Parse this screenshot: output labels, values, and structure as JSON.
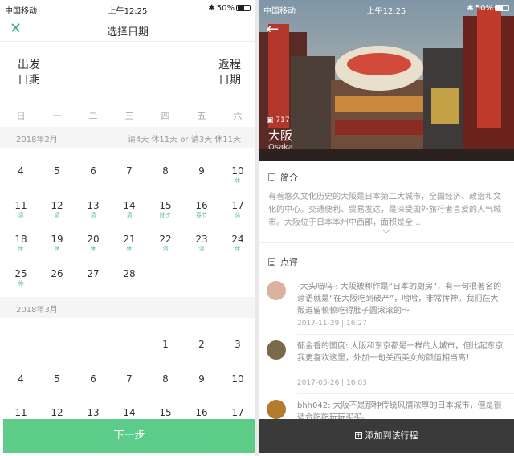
{
  "status_left": {
    "carrier": "中国移动",
    "time": "上午12:25",
    "battery": "50%"
  },
  "status_right": {
    "carrier": "中国移动",
    "time": "上午12:25",
    "battery": "50%"
  },
  "calendar": {
    "close_icon": "close-icon",
    "title": "选择日期",
    "departure": [
      "出发",
      "日期"
    ],
    "return": [
      "返程",
      "日期"
    ],
    "weekdays": [
      "日",
      "一",
      "二",
      "三",
      "四",
      "五",
      "六"
    ],
    "months": [
      {
        "label": "2018年2月",
        "note": "请4天 休11天 or 请3天 休11天",
        "rows": [
          [
            {
              "d": "4",
              "t": ""
            },
            {
              "d": "5",
              "t": ""
            },
            {
              "d": "6",
              "t": ""
            },
            {
              "d": "7",
              "t": ""
            },
            {
              "d": "8",
              "t": ""
            },
            {
              "d": "9",
              "t": ""
            },
            {
              "d": "10",
              "t": "休"
            }
          ],
          [
            {
              "d": "11",
              "t": "请"
            },
            {
              "d": "12",
              "t": "请"
            },
            {
              "d": "13",
              "t": "请"
            },
            {
              "d": "14",
              "t": "请"
            },
            {
              "d": "15",
              "t": "除夕"
            },
            {
              "d": "16",
              "t": "春节"
            },
            {
              "d": "17",
              "t": "休"
            }
          ],
          [
            {
              "d": "18",
              "t": "休"
            },
            {
              "d": "19",
              "t": "休"
            },
            {
              "d": "20",
              "t": "休"
            },
            {
              "d": "21",
              "t": "休"
            },
            {
              "d": "22",
              "t": "请"
            },
            {
              "d": "23",
              "t": "请"
            },
            {
              "d": "24",
              "t": "休"
            }
          ],
          [
            {
              "d": "25",
              "t": "休"
            },
            {
              "d": "26",
              "t": ""
            },
            {
              "d": "27",
              "t": ""
            },
            {
              "d": "28",
              "t": ""
            }
          ]
        ]
      },
      {
        "label": "2018年3月",
        "note": "",
        "rows": [
          [
            {
              "d": "",
              "t": ""
            },
            {
              "d": "",
              "t": ""
            },
            {
              "d": "",
              "t": ""
            },
            {
              "d": "",
              "t": ""
            },
            {
              "d": "1",
              "t": ""
            },
            {
              "d": "2",
              "t": ""
            },
            {
              "d": "3",
              "t": ""
            }
          ],
          [
            {
              "d": "4",
              "t": ""
            },
            {
              "d": "5",
              "t": ""
            },
            {
              "d": "6",
              "t": ""
            },
            {
              "d": "7",
              "t": ""
            },
            {
              "d": "8",
              "t": ""
            },
            {
              "d": "9",
              "t": ""
            },
            {
              "d": "10",
              "t": ""
            }
          ],
          [
            {
              "d": "11",
              "t": ""
            },
            {
              "d": "12",
              "t": ""
            },
            {
              "d": "13",
              "t": ""
            },
            {
              "d": "14",
              "t": ""
            },
            {
              "d": "15",
              "t": ""
            },
            {
              "d": "16",
              "t": ""
            },
            {
              "d": "17",
              "t": ""
            }
          ]
        ]
      }
    ],
    "next_button": "下一步",
    "accent_color": "#55c983"
  },
  "city": {
    "back_icon": "back-arrow-icon",
    "photo_count": "717",
    "name": "大阪",
    "name_en": "Osaka",
    "intro_heading": "简介",
    "intro_text": "有着悠久文化历史的大阪是日本第二大城市，全国经济、政治和文化的中心。交通便利、贸易发达，是深受国外旅行者喜爱的人气城市。大阪位于日本本州中西部，面积是全…",
    "expand_icon": "chevron-down-icon",
    "reviews_heading": "点评",
    "reviews": [
      {
        "text": "-大头喵呜-: 大阪被称作是“日本的厨房”，有一句很著名的谚语就是“在大阪吃到破产”，哈哈，非常传神。我们在大阪逗留顿顿吃得肚子圆滚滚的～",
        "date": "2017-11-29 | 16:27"
      },
      {
        "text": "郁金香的国度: 大阪和东京都是一样的大城市，但比起东京我更喜欢这里，外加一句关西美女的颜值相当高！",
        "date": "2017-05-26 | 16:03"
      },
      {
        "text": "bhh042: 大阪不是那种传统风情浓厚的日本城市，但是很适合吃吃玩玩买买。",
        "date": ""
      }
    ],
    "add_button": "添加到该行程"
  }
}
